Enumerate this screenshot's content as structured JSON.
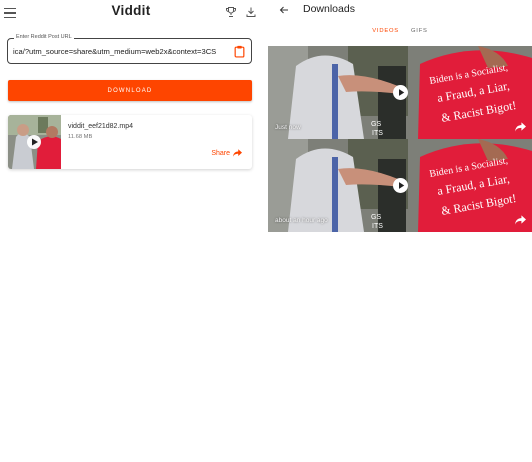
{
  "left_screen": {
    "header": {
      "title": "Viddit",
      "icons": {
        "menu": "menu-icon",
        "trophy": "trophy-icon",
        "downloads": "download-icon"
      }
    },
    "url_field": {
      "label": "Enter Reddit Post URL",
      "value": "ica/?utm_source=share&utm_medium=web2x&context=3CS",
      "icon": "clipboard-icon"
    },
    "download_button": {
      "label": "DOWNLOAD"
    },
    "file_card": {
      "file_name": "viddit_eef21d82.mp4",
      "file_size": "11.68 MB",
      "share_label": "Share",
      "share_icon": "share-arrow-icon"
    }
  },
  "right_screen": {
    "header": {
      "title": "Downloads",
      "back_icon": "back-arrow-icon"
    },
    "tabs": [
      {
        "label": "VIDEOS",
        "active": true
      },
      {
        "label": "GIFS",
        "active": false
      }
    ],
    "videos": [
      {
        "caption": "Just now",
        "play_icon": "play-icon",
        "share_icon": "share-arrow-icon"
      },
      {
        "caption": "about an hour ago",
        "play_icon": "play-icon",
        "share_icon": "share-arrow-icon"
      }
    ]
  },
  "colors": {
    "accent": "#fe4500",
    "shirt_red": "#e11d3a",
    "text_dark": "#222222"
  }
}
